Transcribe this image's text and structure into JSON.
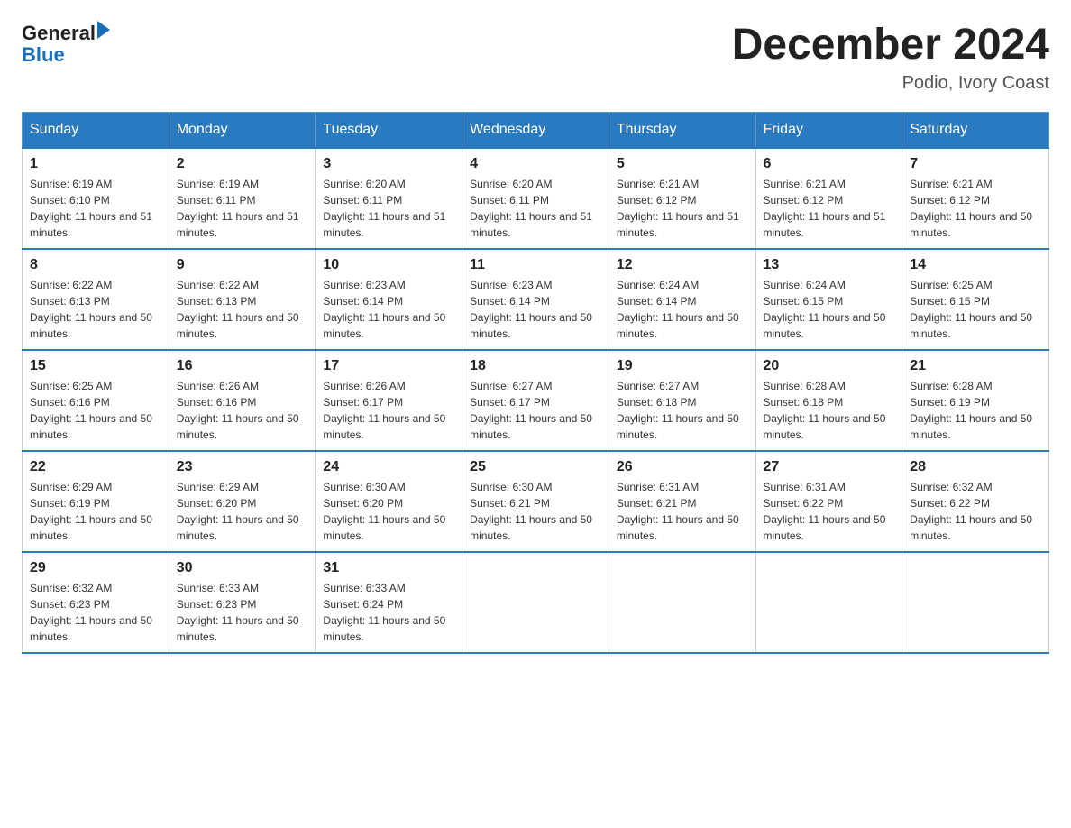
{
  "header": {
    "logo": {
      "text_general": "General",
      "text_blue": "Blue",
      "triangle": true
    },
    "title": "December 2024",
    "subtitle": "Podio, Ivory Coast"
  },
  "weekdays": [
    "Sunday",
    "Monday",
    "Tuesday",
    "Wednesday",
    "Thursday",
    "Friday",
    "Saturday"
  ],
  "weeks": [
    [
      {
        "day": "1",
        "sunrise": "6:19 AM",
        "sunset": "6:10 PM",
        "daylight": "11 hours and 51 minutes."
      },
      {
        "day": "2",
        "sunrise": "6:19 AM",
        "sunset": "6:11 PM",
        "daylight": "11 hours and 51 minutes."
      },
      {
        "day": "3",
        "sunrise": "6:20 AM",
        "sunset": "6:11 PM",
        "daylight": "11 hours and 51 minutes."
      },
      {
        "day": "4",
        "sunrise": "6:20 AM",
        "sunset": "6:11 PM",
        "daylight": "11 hours and 51 minutes."
      },
      {
        "day": "5",
        "sunrise": "6:21 AM",
        "sunset": "6:12 PM",
        "daylight": "11 hours and 51 minutes."
      },
      {
        "day": "6",
        "sunrise": "6:21 AM",
        "sunset": "6:12 PM",
        "daylight": "11 hours and 51 minutes."
      },
      {
        "day": "7",
        "sunrise": "6:21 AM",
        "sunset": "6:12 PM",
        "daylight": "11 hours and 50 minutes."
      }
    ],
    [
      {
        "day": "8",
        "sunrise": "6:22 AM",
        "sunset": "6:13 PM",
        "daylight": "11 hours and 50 minutes."
      },
      {
        "day": "9",
        "sunrise": "6:22 AM",
        "sunset": "6:13 PM",
        "daylight": "11 hours and 50 minutes."
      },
      {
        "day": "10",
        "sunrise": "6:23 AM",
        "sunset": "6:14 PM",
        "daylight": "11 hours and 50 minutes."
      },
      {
        "day": "11",
        "sunrise": "6:23 AM",
        "sunset": "6:14 PM",
        "daylight": "11 hours and 50 minutes."
      },
      {
        "day": "12",
        "sunrise": "6:24 AM",
        "sunset": "6:14 PM",
        "daylight": "11 hours and 50 minutes."
      },
      {
        "day": "13",
        "sunrise": "6:24 AM",
        "sunset": "6:15 PM",
        "daylight": "11 hours and 50 minutes."
      },
      {
        "day": "14",
        "sunrise": "6:25 AM",
        "sunset": "6:15 PM",
        "daylight": "11 hours and 50 minutes."
      }
    ],
    [
      {
        "day": "15",
        "sunrise": "6:25 AM",
        "sunset": "6:16 PM",
        "daylight": "11 hours and 50 minutes."
      },
      {
        "day": "16",
        "sunrise": "6:26 AM",
        "sunset": "6:16 PM",
        "daylight": "11 hours and 50 minutes."
      },
      {
        "day": "17",
        "sunrise": "6:26 AM",
        "sunset": "6:17 PM",
        "daylight": "11 hours and 50 minutes."
      },
      {
        "day": "18",
        "sunrise": "6:27 AM",
        "sunset": "6:17 PM",
        "daylight": "11 hours and 50 minutes."
      },
      {
        "day": "19",
        "sunrise": "6:27 AM",
        "sunset": "6:18 PM",
        "daylight": "11 hours and 50 minutes."
      },
      {
        "day": "20",
        "sunrise": "6:28 AM",
        "sunset": "6:18 PM",
        "daylight": "11 hours and 50 minutes."
      },
      {
        "day": "21",
        "sunrise": "6:28 AM",
        "sunset": "6:19 PM",
        "daylight": "11 hours and 50 minutes."
      }
    ],
    [
      {
        "day": "22",
        "sunrise": "6:29 AM",
        "sunset": "6:19 PM",
        "daylight": "11 hours and 50 minutes."
      },
      {
        "day": "23",
        "sunrise": "6:29 AM",
        "sunset": "6:20 PM",
        "daylight": "11 hours and 50 minutes."
      },
      {
        "day": "24",
        "sunrise": "6:30 AM",
        "sunset": "6:20 PM",
        "daylight": "11 hours and 50 minutes."
      },
      {
        "day": "25",
        "sunrise": "6:30 AM",
        "sunset": "6:21 PM",
        "daylight": "11 hours and 50 minutes."
      },
      {
        "day": "26",
        "sunrise": "6:31 AM",
        "sunset": "6:21 PM",
        "daylight": "11 hours and 50 minutes."
      },
      {
        "day": "27",
        "sunrise": "6:31 AM",
        "sunset": "6:22 PM",
        "daylight": "11 hours and 50 minutes."
      },
      {
        "day": "28",
        "sunrise": "6:32 AM",
        "sunset": "6:22 PM",
        "daylight": "11 hours and 50 minutes."
      }
    ],
    [
      {
        "day": "29",
        "sunrise": "6:32 AM",
        "sunset": "6:23 PM",
        "daylight": "11 hours and 50 minutes."
      },
      {
        "day": "30",
        "sunrise": "6:33 AM",
        "sunset": "6:23 PM",
        "daylight": "11 hours and 50 minutes."
      },
      {
        "day": "31",
        "sunrise": "6:33 AM",
        "sunset": "6:24 PM",
        "daylight": "11 hours and 50 minutes."
      },
      null,
      null,
      null,
      null
    ]
  ],
  "labels": {
    "sunrise": "Sunrise:",
    "sunset": "Sunset:",
    "daylight": "Daylight:"
  }
}
